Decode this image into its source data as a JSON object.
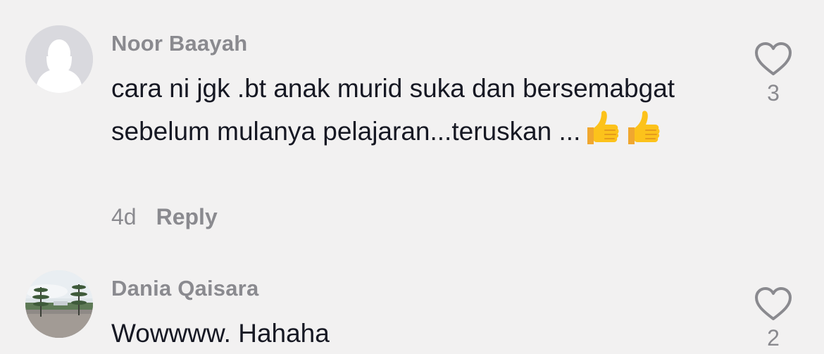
{
  "comments": [
    {
      "username": "Noor Baayah",
      "text": "cara ni jgk .bt anak murid suka dan bersemabgat sebelum mulanya pelajaran...teruskan ...",
      "emojis": [
        "thumbs-up",
        "thumbs-up"
      ],
      "time": "4d",
      "reply_label": "Reply",
      "like_count": "3"
    },
    {
      "username": "Dania Qaisara",
      "text": "Wowwww. Hahaha",
      "like_count": "2"
    }
  ]
}
